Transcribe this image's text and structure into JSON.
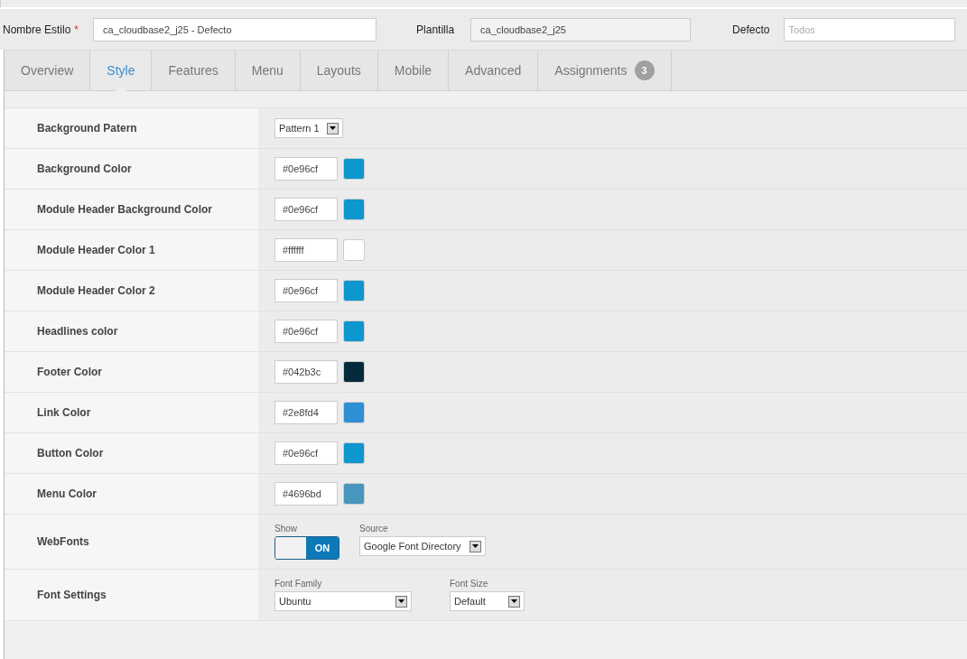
{
  "header": {
    "name_label": "Nombre Estilo",
    "required_mark": "*",
    "name_value": "ca_cloudbase2_j25 - Defecto",
    "template_label": "Plantilla",
    "template_value": "ca_cloudbase2_j25",
    "default_label": "Defecto",
    "default_placeholder": "Todos"
  },
  "tabs": [
    {
      "label": "Overview",
      "selected": false
    },
    {
      "label": "Style",
      "selected": true
    },
    {
      "label": "Features",
      "selected": false
    },
    {
      "label": "Menu",
      "selected": false
    },
    {
      "label": "Layouts",
      "selected": false
    },
    {
      "label": "Mobile",
      "selected": false
    },
    {
      "label": "Advanced",
      "selected": false
    },
    {
      "label": "Assignments",
      "selected": false,
      "badge": "3"
    }
  ],
  "settings": [
    {
      "kind": "select",
      "label": "Background Patern",
      "value": "Pattern 1"
    },
    {
      "kind": "color",
      "label": "Background Color",
      "value": "#0e96cf",
      "color": "#0e96cf"
    },
    {
      "kind": "color",
      "label": "Module Header Background Color",
      "value": "#0e96cf",
      "color": "#0e96cf"
    },
    {
      "kind": "color",
      "label": "Module Header Color 1",
      "value": "#ffffff",
      "color": "#ffffff"
    },
    {
      "kind": "color",
      "label": "Module Header Color 2",
      "value": "#0e96cf",
      "color": "#0e96cf"
    },
    {
      "kind": "color",
      "label": "Headlines color",
      "value": "#0e96cf",
      "color": "#0e96cf"
    },
    {
      "kind": "color",
      "label": "Footer Color",
      "value": "#042b3c",
      "color": "#042b3c"
    },
    {
      "kind": "color",
      "label": "Link Color",
      "value": "#2e8fd4",
      "color": "#2e8fd4"
    },
    {
      "kind": "color",
      "label": "Button Color",
      "value": "#0e96cf",
      "color": "#0e96cf"
    },
    {
      "kind": "color",
      "label": "Menu Color",
      "value": "#4696bd",
      "color": "#4696bd"
    },
    {
      "kind": "webfonts",
      "label": "WebFonts",
      "show_label": "Show",
      "toggle_text": "ON",
      "on": true,
      "source_label": "Source",
      "source_value": "Google Font Directory"
    },
    {
      "kind": "fonts",
      "label": "Font Settings",
      "family_label": "Font Family",
      "family_value": "Ubuntu",
      "size_label": "Font Size",
      "size_value": "Default"
    }
  ]
}
